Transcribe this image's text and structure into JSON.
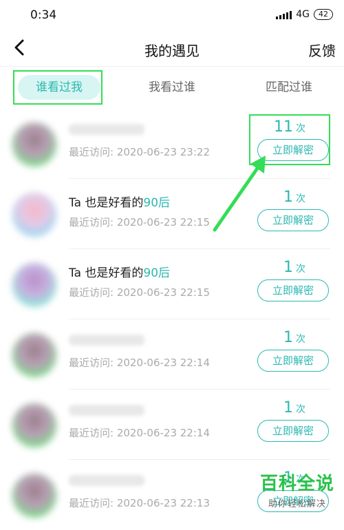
{
  "status_bar": {
    "time": "0:34",
    "network": "4G",
    "battery": "42"
  },
  "header": {
    "title": "我的遇见",
    "feedback": "反馈"
  },
  "tabs": [
    {
      "label": "谁看过我"
    },
    {
      "label": "我看过谁"
    },
    {
      "label": "匹配过谁"
    }
  ],
  "visitors": [
    {
      "name": "",
      "name_prefix": "",
      "name_age": "",
      "visit": "最近访问: 2020-06-23 23:22",
      "count": "11",
      "unit": "次",
      "button": "立即解密"
    },
    {
      "name": "",
      "name_prefix": "Ta 也是好看的",
      "name_age": "90后",
      "visit": "最近访问: 2020-06-23 22:15",
      "count": "1",
      "unit": "次",
      "button": "立即解密"
    },
    {
      "name": "",
      "name_prefix": "Ta 也是好看的",
      "name_age": "90后",
      "visit": "最近访问: 2020-06-23 22:15",
      "count": "1",
      "unit": "次",
      "button": "立即解密"
    },
    {
      "name": "",
      "name_prefix": "",
      "name_age": "",
      "visit": "最近访问: 2020-06-23 22:14",
      "count": "1",
      "unit": "次",
      "button": "立即解密"
    },
    {
      "name": "",
      "name_prefix": "",
      "name_age": "",
      "visit": "最近访问: 2020-06-23 22:14",
      "count": "1",
      "unit": "次",
      "button": "立即解密"
    },
    {
      "name": "",
      "name_prefix": "",
      "name_age": "",
      "visit": "最近访问: 2020-06-23 22:13",
      "count": "1",
      "unit": "次",
      "button": "立即解密"
    }
  ],
  "watermark": {
    "main": "百科全说",
    "sub": "助你轻松解决"
  },
  "colors": {
    "accent": "#2bb8b0",
    "tab_active_bg": "#d7f5f2",
    "annotation": "#33dd55"
  }
}
